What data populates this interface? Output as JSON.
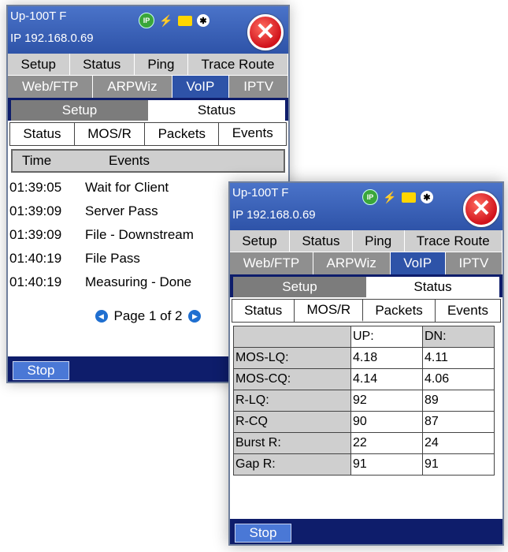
{
  "window1": {
    "device_name": "Up-100T F",
    "ip": "IP 192.168.0.69",
    "icons": [
      "ip-status-icon",
      "network-plug-icon",
      "folder-icon",
      "bluetooth-icon",
      "close-icon"
    ],
    "main_tabs": [
      "Setup",
      "Status",
      "Ping",
      "Trace Route"
    ],
    "sub_tabs": [
      "Web/FTP",
      "ARPWiz",
      "VoIP",
      "IPTV"
    ],
    "active_sub_tab": "VoIP",
    "segments": [
      "Setup",
      "Status"
    ],
    "inner_tabs": [
      "Status",
      "MOS/R",
      "Packets",
      "Events"
    ],
    "active_inner_tab": "Events",
    "events_header": {
      "time": "Time",
      "events": "Events"
    },
    "events": [
      {
        "time": "01:39:05",
        "event": "Wait for Client"
      },
      {
        "time": "01:39:09",
        "event": "Server Pass"
      },
      {
        "time": "01:39:09",
        "event": "File - Downstream"
      },
      {
        "time": "01:40:19",
        "event": "File Pass"
      },
      {
        "time": "01:40:19",
        "event": "Measuring - Done"
      }
    ],
    "pager": "Page 1 of 2",
    "stop_label": "Stop"
  },
  "window2": {
    "device_name": "Up-100T F",
    "ip": "IP 192.168.0.69",
    "main_tabs": [
      "Setup",
      "Status",
      "Ping",
      "Trace Route"
    ],
    "sub_tabs": [
      "Web/FTP",
      "ARPWiz",
      "VoIP",
      "IPTV"
    ],
    "active_sub_tab": "VoIP",
    "segments": [
      "Setup",
      "Status"
    ],
    "inner_tabs": [
      "Status",
      "MOS/R",
      "Packets",
      "Events"
    ],
    "active_inner_tab": "MOS/R",
    "mos_header": {
      "up": "UP:",
      "dn": "DN:"
    },
    "mos_rows": [
      {
        "label": "MOS-LQ:",
        "up": "4.18",
        "dn": "4.11"
      },
      {
        "label": "MOS-CQ:",
        "up": "4.14",
        "dn": "4.06"
      },
      {
        "label": "R-LQ:",
        "up": "92",
        "dn": "89"
      },
      {
        "label": "R-CQ",
        "up": "90",
        "dn": "87"
      },
      {
        "label": "Burst R:",
        "up": "22",
        "dn": "24"
      },
      {
        "label": "Gap R:",
        "up": "91",
        "dn": "91"
      }
    ],
    "stop_label": "Stop"
  },
  "icon_glyphs": {
    "ip": "IP",
    "plug": "⚡",
    "bluetooth": "✱",
    "close": "✕",
    "arrow_left": "◀",
    "arrow_right": "▶"
  },
  "colors": {
    "titlebar": "#2e53a8",
    "active_tab": "#2e53a8",
    "panel": "#0e1d6b",
    "close": "#d0121b",
    "stop_button": "#4a78d6"
  }
}
